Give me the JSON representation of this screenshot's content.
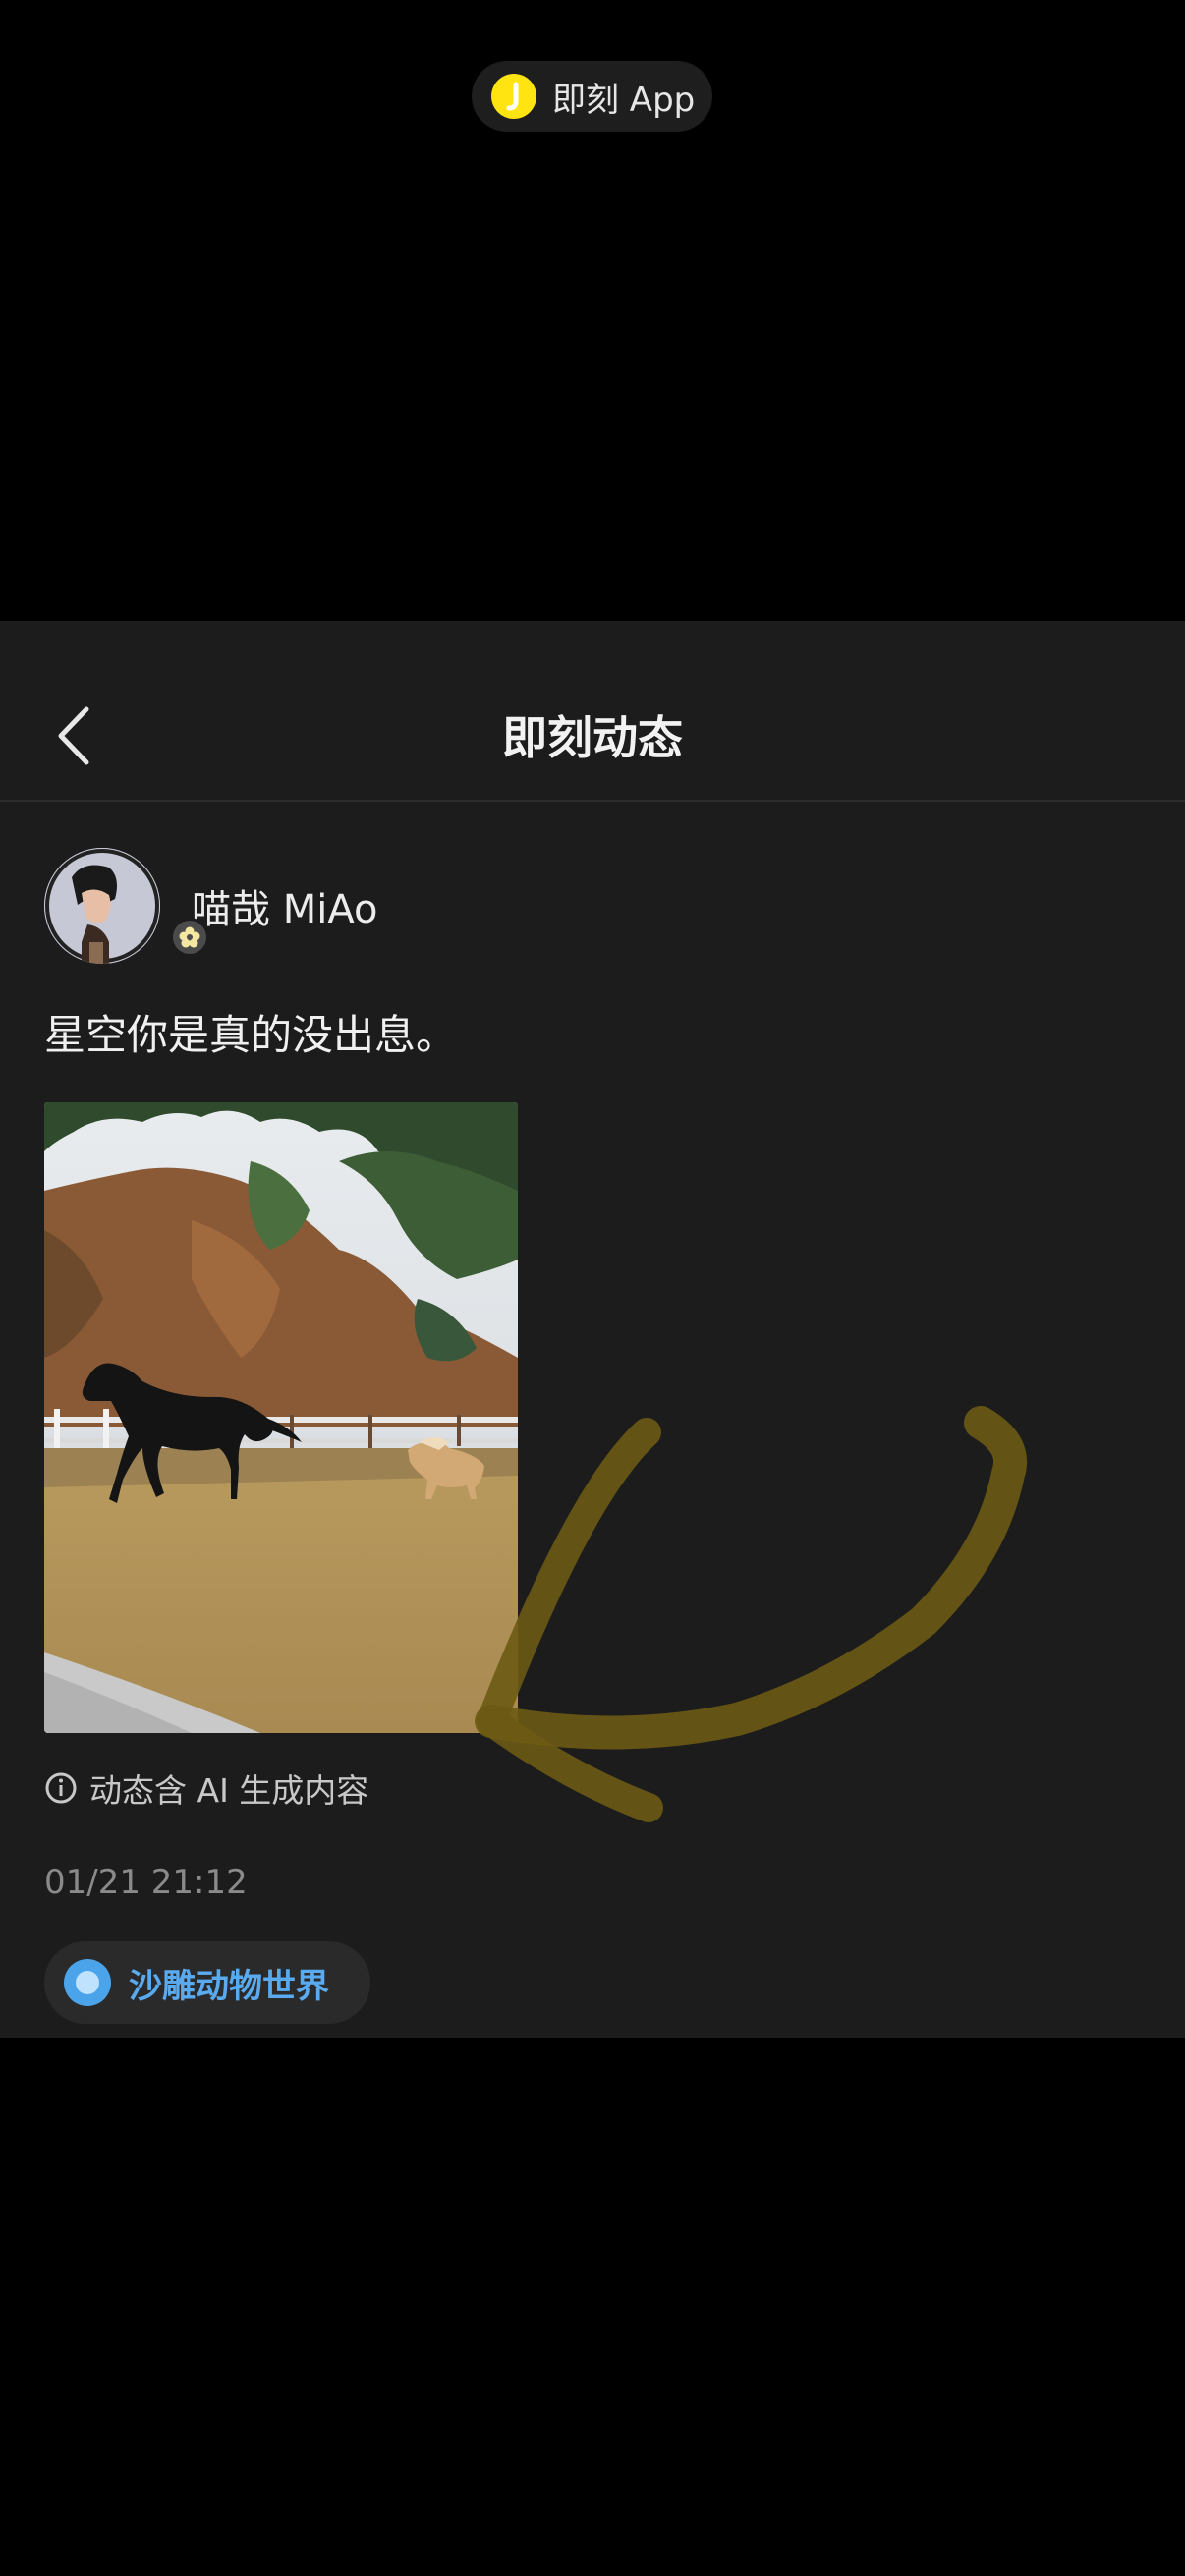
{
  "top_pill": {
    "app_name": "即刻 App",
    "logo_color": "#ffe411"
  },
  "nav": {
    "title": "即刻动态",
    "back_icon": "chevron-left-icon"
  },
  "post": {
    "author_name": "喵哉 MiAo",
    "text": "星空你是真的没出息。",
    "ai_notice": "动态含 AI 生成内容",
    "timestamp": "01/21 21:12",
    "image_description_icon": "photo"
  },
  "topic": {
    "label": "沙雕动物世界",
    "color": "#5aaaf0"
  },
  "colors": {
    "background": "#000000",
    "sheet": "#1c1c1c",
    "annotation_arrow": "#6b5a14"
  }
}
